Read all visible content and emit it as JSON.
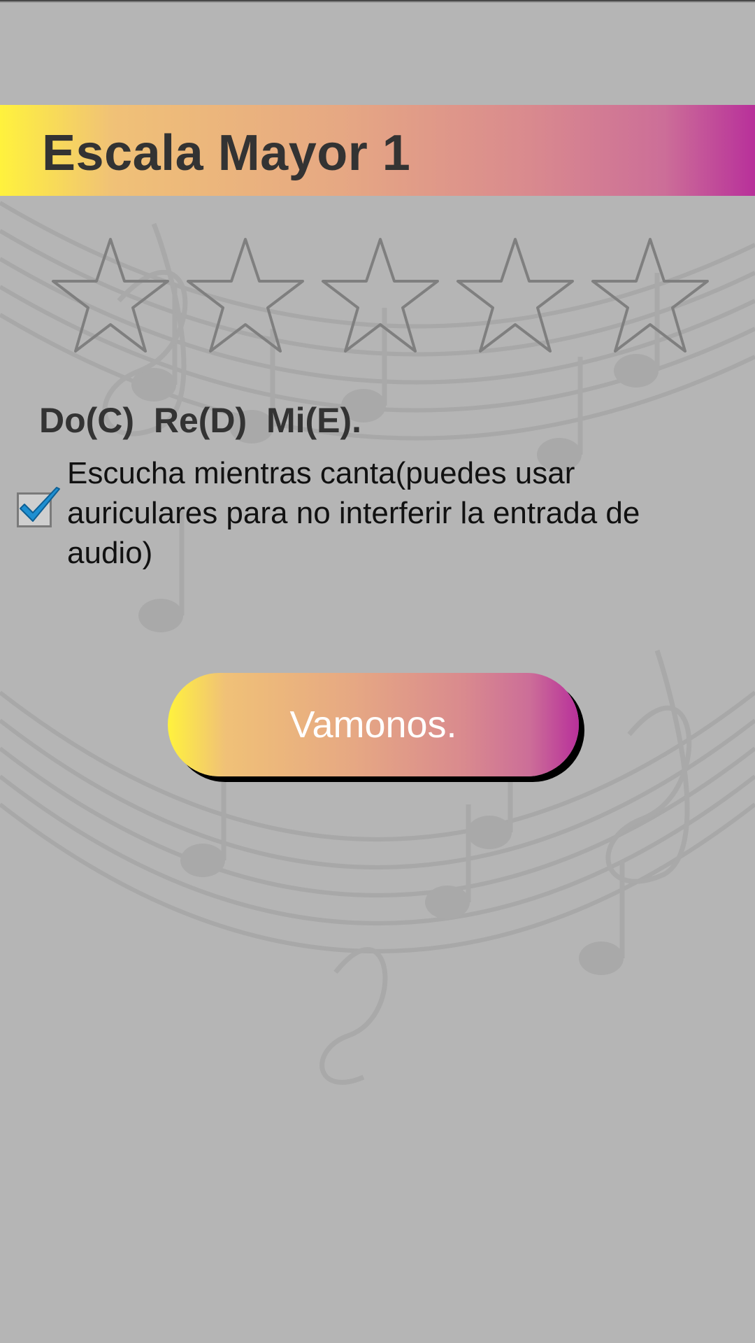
{
  "header": {
    "title": "Escala Mayor 1"
  },
  "rating": {
    "value": 0,
    "max": 5,
    "icon": "star-outline-icon"
  },
  "notes_text": "Do(C)  Re(D)  Mi(E).",
  "listen_option": {
    "checked": true,
    "label": "Escucha mientras canta(puedes usar auriculares para no interferir la entrada de audio)"
  },
  "primary_button": {
    "label": "Vamonos."
  },
  "colors": {
    "background": "#b5b5b5",
    "gradient_start": "#fff23d",
    "gradient_mid": "#e6a883",
    "gradient_end": "#b8309a",
    "title_text": "#333333",
    "check_accent": "#1e8fd1"
  }
}
